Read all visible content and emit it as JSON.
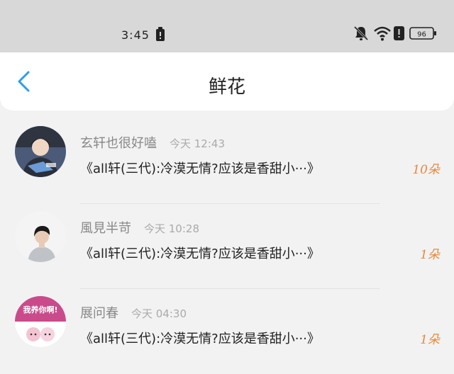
{
  "status_bar": {
    "time": "3:45",
    "battery_level": "96",
    "icons": [
      "alert-icon",
      "mute-bell-icon",
      "wifi-icon",
      "alert-icon",
      "battery-icon"
    ]
  },
  "nav": {
    "title": "鲜花",
    "back_icon": "chevron-left-icon",
    "accent_color": "#2e9cf0"
  },
  "items": [
    {
      "name": "玄轩也很好嗑",
      "time": "今天 12:43",
      "book": "《all轩(三代):冷漠无情?应该是香甜小···》",
      "count": "10朵"
    },
    {
      "name": "風見半苛",
      "time": "今天 10:28",
      "book": "《all轩(三代):冷漠无情?应该是香甜小···》",
      "count": "1朵"
    },
    {
      "name": "展问春",
      "time": "今天 04:30",
      "book": "《all轩(三代):冷漠无情?应该是香甜小···》",
      "count": "1朵",
      "avatar_text": "我养你啊!"
    }
  ],
  "colors": {
    "count": "#e8883a",
    "status_bar_bg": "#d8d8d8",
    "page_bg": "#f2f2f2"
  }
}
